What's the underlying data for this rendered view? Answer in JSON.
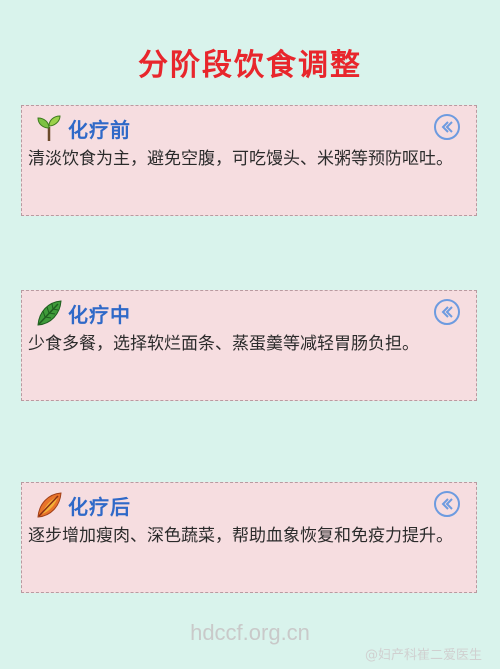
{
  "title": "分阶段饮食调整",
  "cards": [
    {
      "icon": "sprout-icon",
      "title": "化疗前",
      "body": "清淡饮食为主，避免空腹，可吃馒头、米粥等预防呕吐。"
    },
    {
      "icon": "leaf-icon",
      "title": "化疗中",
      "body": "少食多餐，选择软烂面条、蒸蛋羹等减轻胃肠负担。"
    },
    {
      "icon": "autumn-leaf-icon",
      "title": "化疗后",
      "body": "逐步增加瘦肉、深色蔬菜，帮助血象恢复和免疫力提升。"
    }
  ],
  "footer": {
    "url": "hdccf.org.cn",
    "credit": "@妇产科崔二爱医生"
  },
  "colors": {
    "background": "#d9f3ec",
    "title": "#e8262c",
    "card_title": "#2f69c8",
    "card_bg": "#f6dde0"
  }
}
